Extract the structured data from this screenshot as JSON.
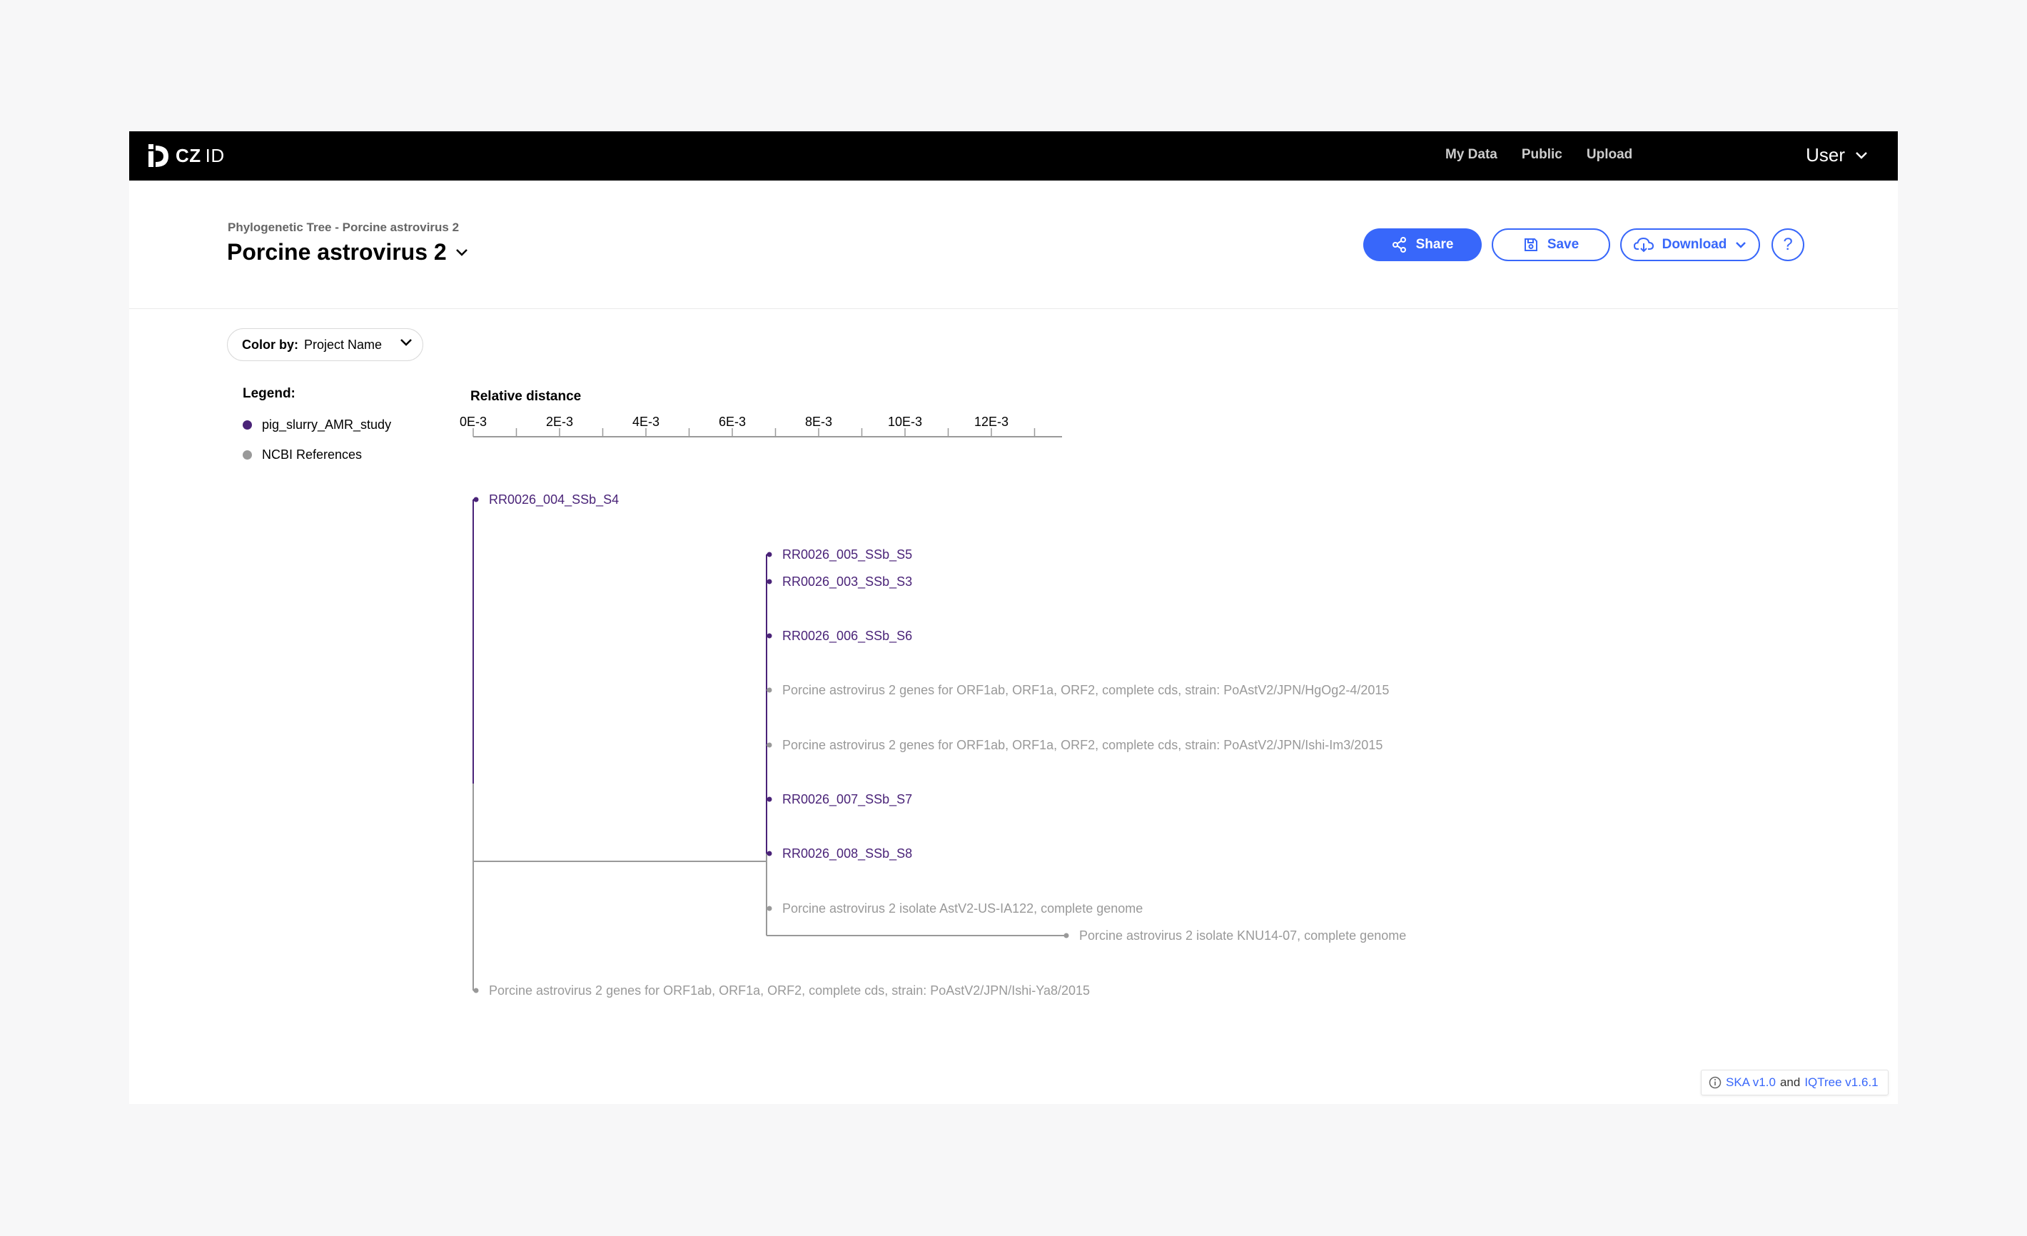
{
  "app": {
    "logo_text": "CZ",
    "logo_text_thin": "ID",
    "nav": [
      "My Data",
      "Public",
      "Upload"
    ],
    "user_label": "User"
  },
  "header": {
    "breadcrumb": "Phylogenetic Tree - Porcine astrovirus 2",
    "title": "Porcine astrovirus 2",
    "share_label": "Share",
    "save_label": "Save",
    "download_label": "Download",
    "help_label": "?"
  },
  "color_by": {
    "label": "Color by:",
    "value": "Project Name"
  },
  "legend": {
    "title": "Legend:",
    "items": [
      {
        "label": "pig_slurry_AMR_study",
        "color": "#4a2378"
      },
      {
        "label": "NCBI References",
        "color": "#999999"
      }
    ]
  },
  "axis": {
    "title": "Relative distance",
    "ticks": [
      "0E-3",
      "2E-3",
      "4E-3",
      "6E-3",
      "8E-3",
      "10E-3",
      "12E-3"
    ]
  },
  "tree": {
    "sample_color": "#4a2378",
    "reference_color": "#999999",
    "leaves": [
      {
        "label": "RR0026_004_SSb_S4",
        "group": "pig_slurry_AMR_study"
      },
      {
        "label": "RR0026_005_SSb_S5",
        "group": "pig_slurry_AMR_study"
      },
      {
        "label": "RR0026_003_SSb_S3",
        "group": "pig_slurry_AMR_study"
      },
      {
        "label": "RR0026_006_SSb_S6",
        "group": "pig_slurry_AMR_study"
      },
      {
        "label": "Porcine astrovirus 2 genes for ORF1ab, ORF1a, ORF2, complete cds, strain: PoAstV2/JPN/HgOg2-4/2015",
        "group": "NCBI References"
      },
      {
        "label": "Porcine astrovirus 2 genes for ORF1ab, ORF1a, ORF2, complete cds, strain: PoAstV2/JPN/Ishi-Im3/2015",
        "group": "NCBI References"
      },
      {
        "label": "RR0026_007_SSb_S7",
        "group": "pig_slurry_AMR_study"
      },
      {
        "label": "RR0026_008_SSb_S8",
        "group": "pig_slurry_AMR_study"
      },
      {
        "label": "Porcine astrovirus 2 isolate AstV2-US-IA122, complete genome",
        "group": "NCBI References"
      },
      {
        "label": "Porcine astrovirus 2 isolate KNU14-07, complete genome",
        "group": "NCBI References"
      },
      {
        "label": "Porcine astrovirus 2 genes for ORF1ab, ORF1a, ORF2, complete cds, strain: PoAstV2/JPN/Ishi-Ya8/2015",
        "group": "NCBI References"
      }
    ]
  },
  "footer": {
    "ska": "SKA v1.0",
    "and": "and",
    "iqtree": "IQTree v1.6.1"
  }
}
